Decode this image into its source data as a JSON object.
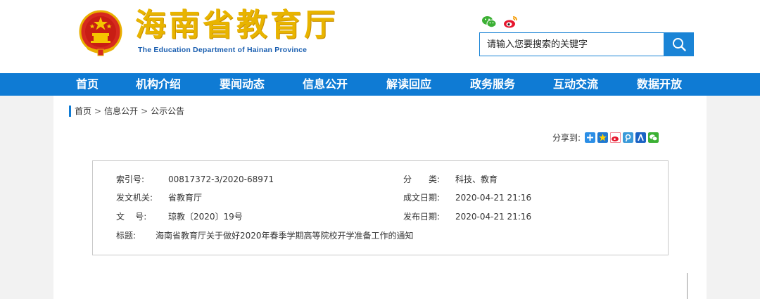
{
  "header": {
    "title_cn": "海南省教育厅",
    "title_en": "The Education Department of Hainan Province",
    "search_placeholder": "请输入您要搜索的关键字"
  },
  "nav": [
    {
      "label": "首页"
    },
    {
      "label": "机构介绍"
    },
    {
      "label": "要闻动态"
    },
    {
      "label": "信息公开"
    },
    {
      "label": "解读回应"
    },
    {
      "label": "政务服务"
    },
    {
      "label": "互动交流"
    },
    {
      "label": "数据开放"
    }
  ],
  "breadcrumb": {
    "home": "首页",
    "sep": ">",
    "level1": "信息公开",
    "level2": "公示公告"
  },
  "share": {
    "label": "分享到:"
  },
  "meta": {
    "index_label": "索引号:",
    "index_value": "00817372-3/2020-68971",
    "category_label": "分　　类:",
    "category_value": "科技、教育",
    "issuer_label": "发文机关:",
    "issuer_value": "省教育厅",
    "created_label": "成文日期:",
    "created_value": "2020-04-21 21:16",
    "docno_label": "文    号:",
    "docno_value": "琼教〔2020〕19号",
    "published_label": "发布日期:",
    "published_value": "2020-04-21 21:16",
    "title_label": "标题:",
    "title_value": "海南省教育厅关于做好2020年春季学期高等院校开学准备工作的通知"
  },
  "colors": {
    "nav_blue": "#0f7bd4",
    "logo_gold": "#e8b400",
    "logo_en_blue": "#1b5fb0"
  }
}
